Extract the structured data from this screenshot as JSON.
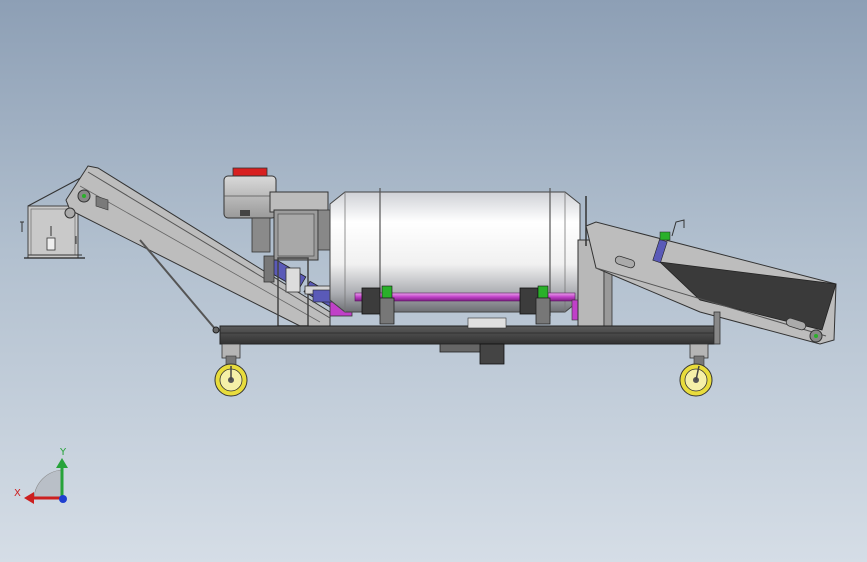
{
  "viewport": {
    "background_top": "#8d9fb5",
    "background_bottom": "#d5dde6"
  },
  "triad": {
    "x_label": "X",
    "y_label": "Y",
    "x_color": "#cc1f1f",
    "y_color": "#27a33a",
    "z_color": "#1f3fd0"
  },
  "model": {
    "drum_color": "#f2f2f2",
    "shaft_color": "#c040c8",
    "frame_color": "#4a4a4a",
    "wheel_rim_color": "#e8dc3c",
    "accent_blue": "#5a5ab8",
    "indicator_red": "#d82020",
    "indicator_green": "#2ab02a"
  }
}
